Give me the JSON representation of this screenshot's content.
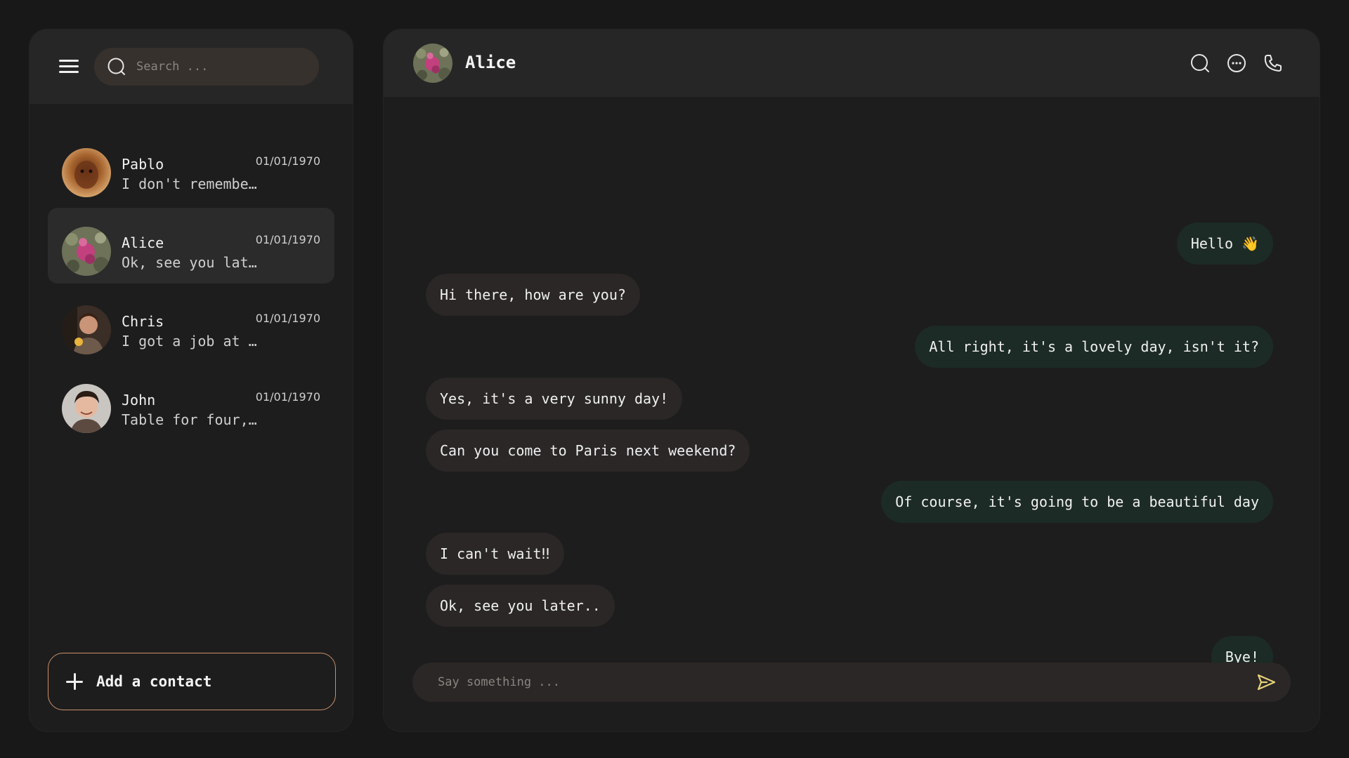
{
  "sidebar": {
    "search": {
      "placeholder": "Search ..."
    },
    "contacts": [
      {
        "name": "Pablo",
        "preview": "I don't remembe…",
        "date": "01/01/1970",
        "active": false
      },
      {
        "name": "Alice",
        "preview": "Ok, see you lat…",
        "date": "01/01/1970",
        "active": true
      },
      {
        "name": "Chris",
        "preview": "I got a job at …",
        "date": "01/01/1970",
        "active": false
      },
      {
        "name": "John",
        "preview": "Table for four,…",
        "date": "01/01/1970",
        "active": false
      }
    ],
    "add_contact_label": "Add a contact"
  },
  "chat": {
    "title": "Alice",
    "header_icons": [
      "search-icon",
      "more-icon",
      "phone-icon"
    ],
    "messages": [
      {
        "direction": "out",
        "text": "Hello 👋"
      },
      {
        "direction": "in",
        "text": "Hi there, how are you?"
      },
      {
        "direction": "out",
        "text": "All right, it's a lovely day, isn't it?"
      },
      {
        "direction": "in",
        "text": "Yes, it's a very sunny day!"
      },
      {
        "direction": "in",
        "text": "Can you come to Paris next weekend?"
      },
      {
        "direction": "out",
        "text": "Of course, it's going to be a beautiful day"
      },
      {
        "direction": "in",
        "text": "I can't wait‼"
      },
      {
        "direction": "in",
        "text": "Ok, see you later.."
      },
      {
        "direction": "out",
        "text": "Bye!"
      }
    ],
    "composer": {
      "placeholder": "Say something ..."
    }
  },
  "colors": {
    "background": "#181818",
    "panel": "#1d1d1d",
    "header": "#262626",
    "incoming_bubble": "#2a2726",
    "outgoing_bubble": "#1c2b25",
    "accent": "#e8d27a",
    "add_border": "#c8906a"
  }
}
